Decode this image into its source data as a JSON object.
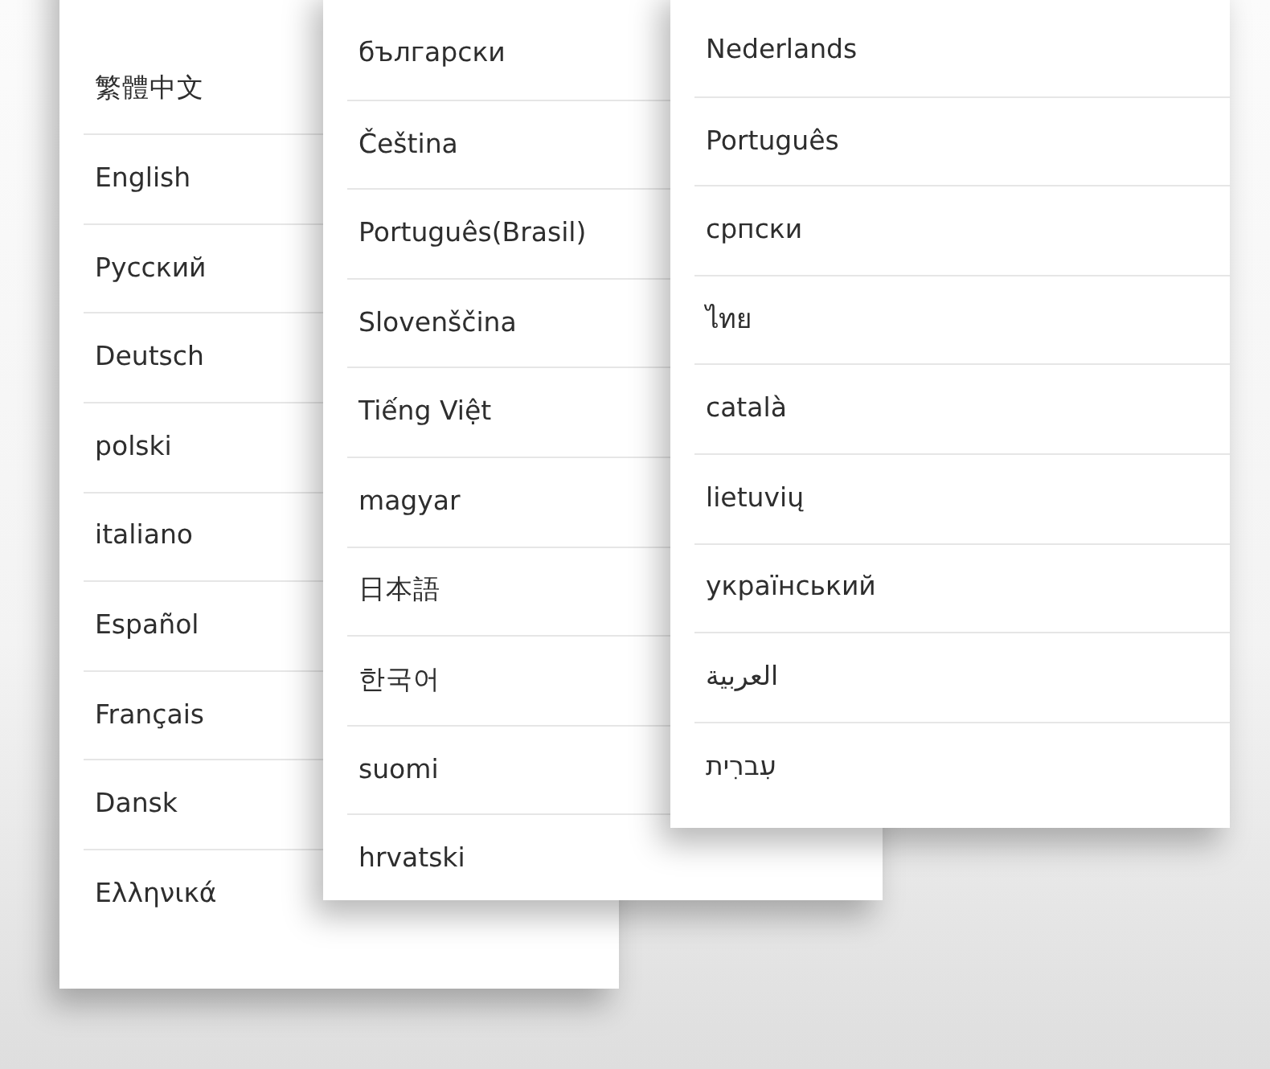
{
  "panels": [
    {
      "languages": [
        "繁體中文",
        "English",
        "Русский",
        "Deutsch",
        "polski",
        "italiano",
        "Español",
        "Français",
        "Dansk",
        "Ελληνικά"
      ]
    },
    {
      "languages": [
        "български",
        "Čeština",
        "Português(Brasil)",
        "Slovenščina",
        "Tiếng Việt",
        "magyar",
        "日本語",
        "한국어",
        "suomi",
        "hrvatski"
      ]
    },
    {
      "languages": [
        "Nederlands",
        "Português",
        "српски",
        "ไทย",
        "català",
        "lietuvių",
        "український",
        "العربية",
        "עִברִית"
      ]
    }
  ]
}
